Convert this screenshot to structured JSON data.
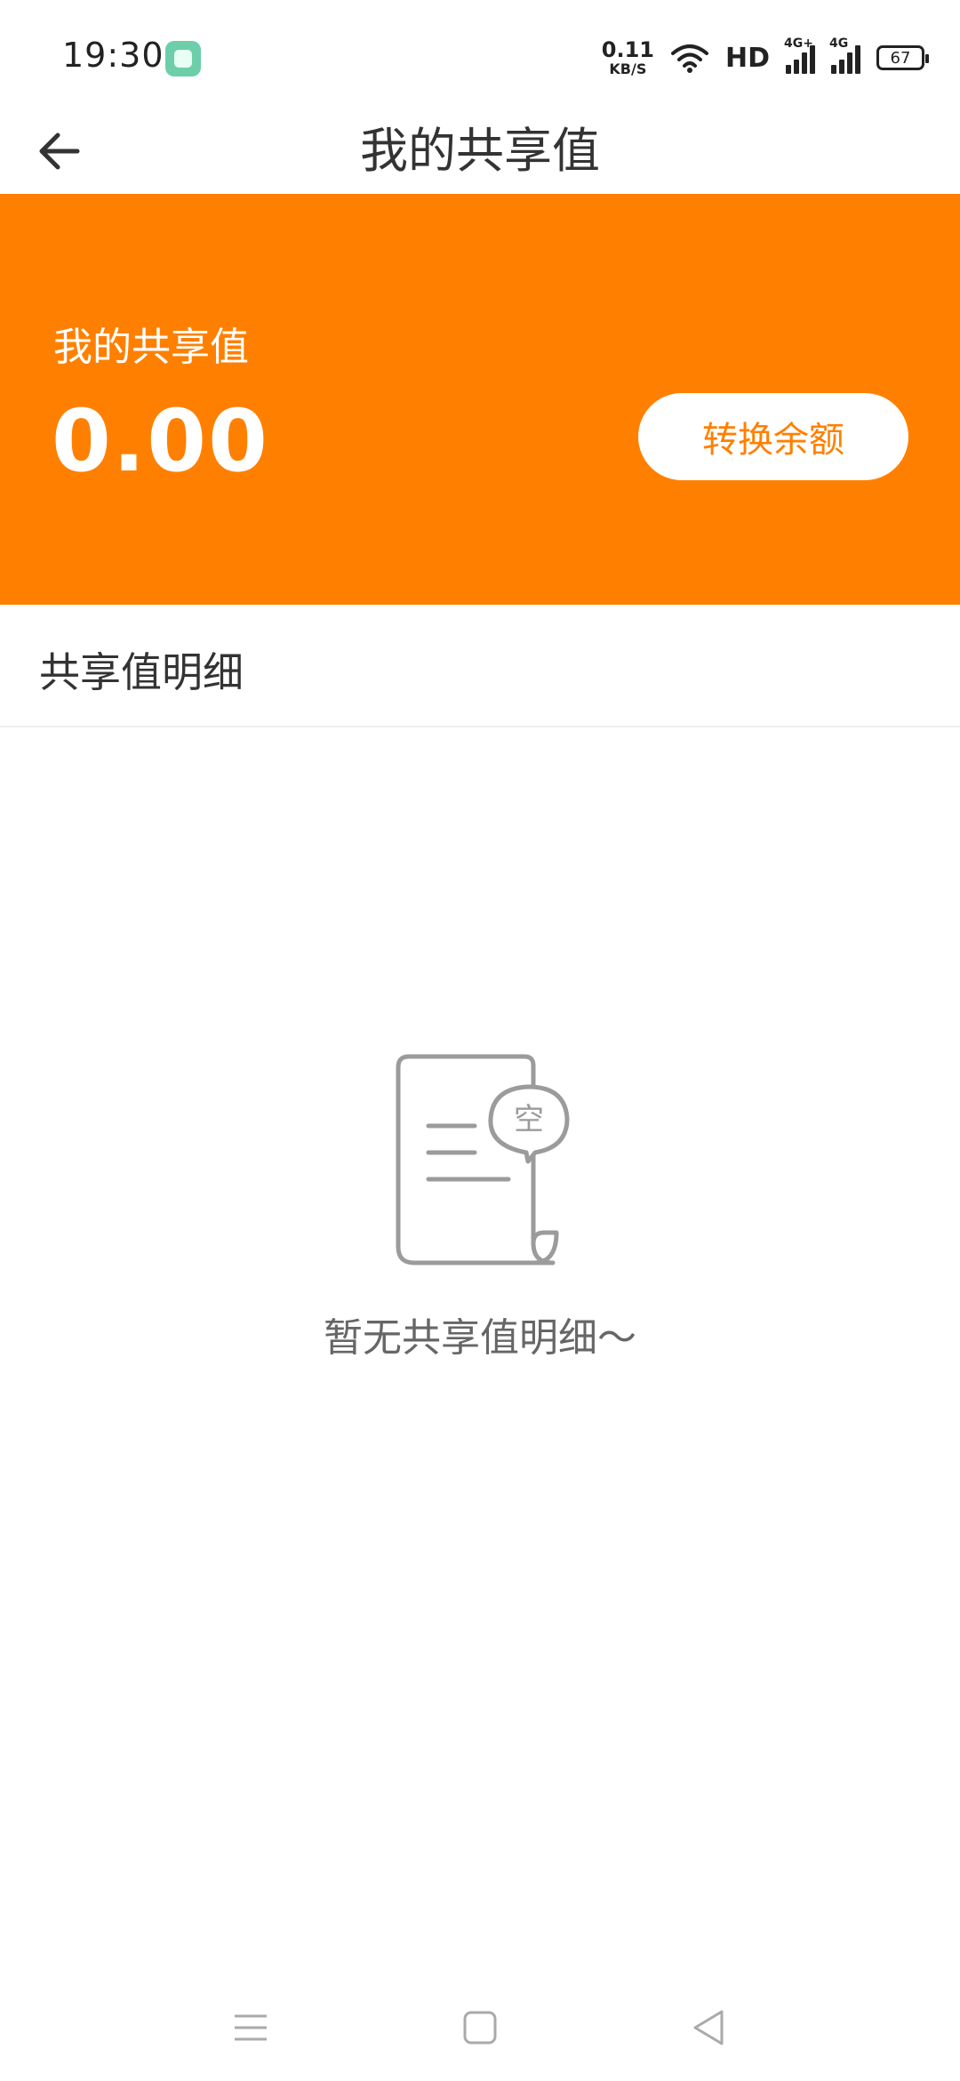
{
  "status_bar": {
    "time": "19:30",
    "net_speed_value": "0.11",
    "net_speed_unit": "KB/S",
    "hd_label": "HD",
    "signal1_label": "4G+",
    "signal2_label": "4G",
    "battery_level": "67",
    "icons": [
      "app-notification-icon",
      "wifi-icon",
      "signal-icon",
      "battery-icon"
    ]
  },
  "header": {
    "title": "我的共享值",
    "back_icon": "arrow-left-icon"
  },
  "balance_card": {
    "label": "我的共享值",
    "value": "0.00",
    "convert_button_label": "转换余额",
    "background_color": "#ff8000",
    "button_text_color": "#ff8000"
  },
  "details_section": {
    "title": "共享值明细"
  },
  "empty_state": {
    "badge_text": "空",
    "message": "暂无共享值明细～",
    "icon": "empty-document-icon"
  },
  "nav_bar": {
    "icons": [
      "menu-icon",
      "home-icon",
      "back-triangle-icon"
    ]
  }
}
